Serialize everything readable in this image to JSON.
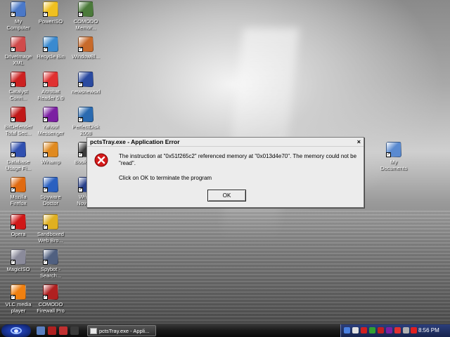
{
  "desktop": {
    "icons": [
      {
        "label": "My\nComputer",
        "icon": "my-computer-icon",
        "color": "#4a78c8"
      },
      {
        "label": "PowerISO",
        "icon": "poweriso-icon",
        "color": "#f0c020"
      },
      {
        "label": "COMODO\nMemor...",
        "icon": "comodo-memory-icon",
        "color": "#4b7a3a"
      },
      {
        "label": "DriveImage\nXML",
        "icon": "driveimage-icon",
        "color": "#d04a4a"
      },
      {
        "label": "Recycle Bin",
        "icon": "recycle-bin-icon",
        "color": "#3a8ad0"
      },
      {
        "label": "WindowBl...",
        "icon": "windowblinds-icon",
        "color": "#c86a2a"
      },
      {
        "label": "Catalyst\nConn...",
        "icon": "catalyst-icon",
        "color": "#cc2020"
      },
      {
        "label": "Acrobat\nReader 5.0",
        "icon": "acrobat-icon",
        "color": "#e03030"
      },
      {
        "label": "newsnewsxl",
        "icon": "newsreader-icon",
        "color": "#2a4aa0"
      },
      {
        "label": "BitDefender\nTotal Sec...",
        "icon": "bitdefender-icon",
        "color": "#c01818"
      },
      {
        "label": "Yahoo!\nMessenger",
        "icon": "yahoo-icon",
        "color": "#7b1fa2"
      },
      {
        "label": "PerfectDisk\n2008",
        "icon": "perfectdisk-icon",
        "color": "#2a6ab0"
      },
      {
        "label": "Database\nUsage Fi...",
        "icon": "database-icon",
        "color": "#3050b0"
      },
      {
        "label": "Winamp",
        "icon": "winamp-icon",
        "color": "#e08a20"
      },
      {
        "label": "Book W...",
        "icon": "book-icon",
        "color": "#3a3a3a"
      },
      {
        "label": "Mozilla\nFirefox",
        "icon": "firefox-icon",
        "color": "#e06a10"
      },
      {
        "label": "Spyware\nDoctor",
        "icon": "spyware-doctor-icon",
        "color": "#2a60c0"
      },
      {
        "label": "Writer\nNovel...",
        "icon": "writer-icon",
        "color": "#28408a"
      },
      {
        "label": "Opera",
        "icon": "opera-icon",
        "color": "#d01818"
      },
      {
        "label": "Sandboxed\nWeb Bro...",
        "icon": "sandboxie-icon",
        "color": "#e0b020"
      },
      {
        "label": "MagicISO",
        "icon": "magiciso-icon",
        "color": "#8a8a9a"
      },
      {
        "label": "Spybot -\nSearch...",
        "icon": "spybot-icon",
        "color": "#506080"
      },
      {
        "label": "VLC media\nplayer",
        "icon": "vlc-icon",
        "color": "#f08010"
      },
      {
        "label": "COMODO\nFirewall Pro",
        "icon": "comodo-firewall-icon",
        "color": "#b02020"
      },
      {
        "label": "My\nDocuments",
        "icon": "my-documents-icon",
        "color": "#5a8ad0"
      }
    ]
  },
  "dialog": {
    "title": "pctsTray.exe - Application Error",
    "close_glyph": "×",
    "message": "The instruction at \"0x51f265c2\" referenced memory at \"0x013d4e70\". The memory could not be \"read\".",
    "message2": "Click on OK to terminate the program",
    "ok_label": "OK",
    "icon": "error-icon"
  },
  "taskbar": {
    "task_label": "pctsTray.exe - Appli...",
    "clock": "8:56 PM",
    "start_icon": "start-eye-icon"
  }
}
